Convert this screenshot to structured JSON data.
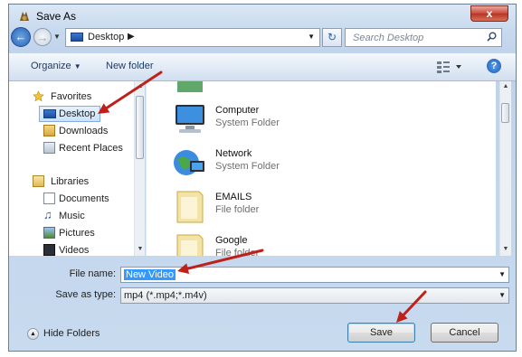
{
  "window": {
    "title": "Save As",
    "close_label": "x"
  },
  "address": {
    "location": "Desktop",
    "search_placeholder": "Search Desktop"
  },
  "toolbar": {
    "organize_label": "Organize",
    "new_folder_label": "New folder",
    "help_label": "?"
  },
  "nav": {
    "favorites_label": "Favorites",
    "favorites": [
      {
        "label": "Desktop",
        "icon": "desktop-icon",
        "selected": true
      },
      {
        "label": "Downloads",
        "icon": "downloads-icon"
      },
      {
        "label": "Recent Places",
        "icon": "recent-places-icon"
      }
    ],
    "libraries_label": "Libraries",
    "libraries": [
      {
        "label": "Documents",
        "icon": "documents-icon"
      },
      {
        "label": "Music",
        "icon": "music-icon"
      },
      {
        "label": "Pictures",
        "icon": "pictures-icon"
      },
      {
        "label": "Videos",
        "icon": "videos-icon"
      }
    ]
  },
  "files": [
    {
      "name": "Computer",
      "type": "System Folder",
      "icon": "computer-icon"
    },
    {
      "name": "Network",
      "type": "System Folder",
      "icon": "network-icon"
    },
    {
      "name": "EMAILS",
      "type": "File folder",
      "icon": "folder-icon"
    },
    {
      "name": "Google",
      "type": "File folder",
      "icon": "folder-icon"
    }
  ],
  "form": {
    "file_name_label": "File name:",
    "file_name_value": "New Video",
    "save_as_type_label": "Save as type:",
    "save_as_type_value": "mp4 (*.mp4;*.m4v)"
  },
  "footer": {
    "hide_folders_label": "Hide Folders",
    "save_label": "Save",
    "cancel_label": "Cancel"
  },
  "annotation": {
    "arrow_color": "#c0201a"
  },
  "colors": {
    "selection": "#3399ff",
    "accent": "#2a64b8"
  }
}
